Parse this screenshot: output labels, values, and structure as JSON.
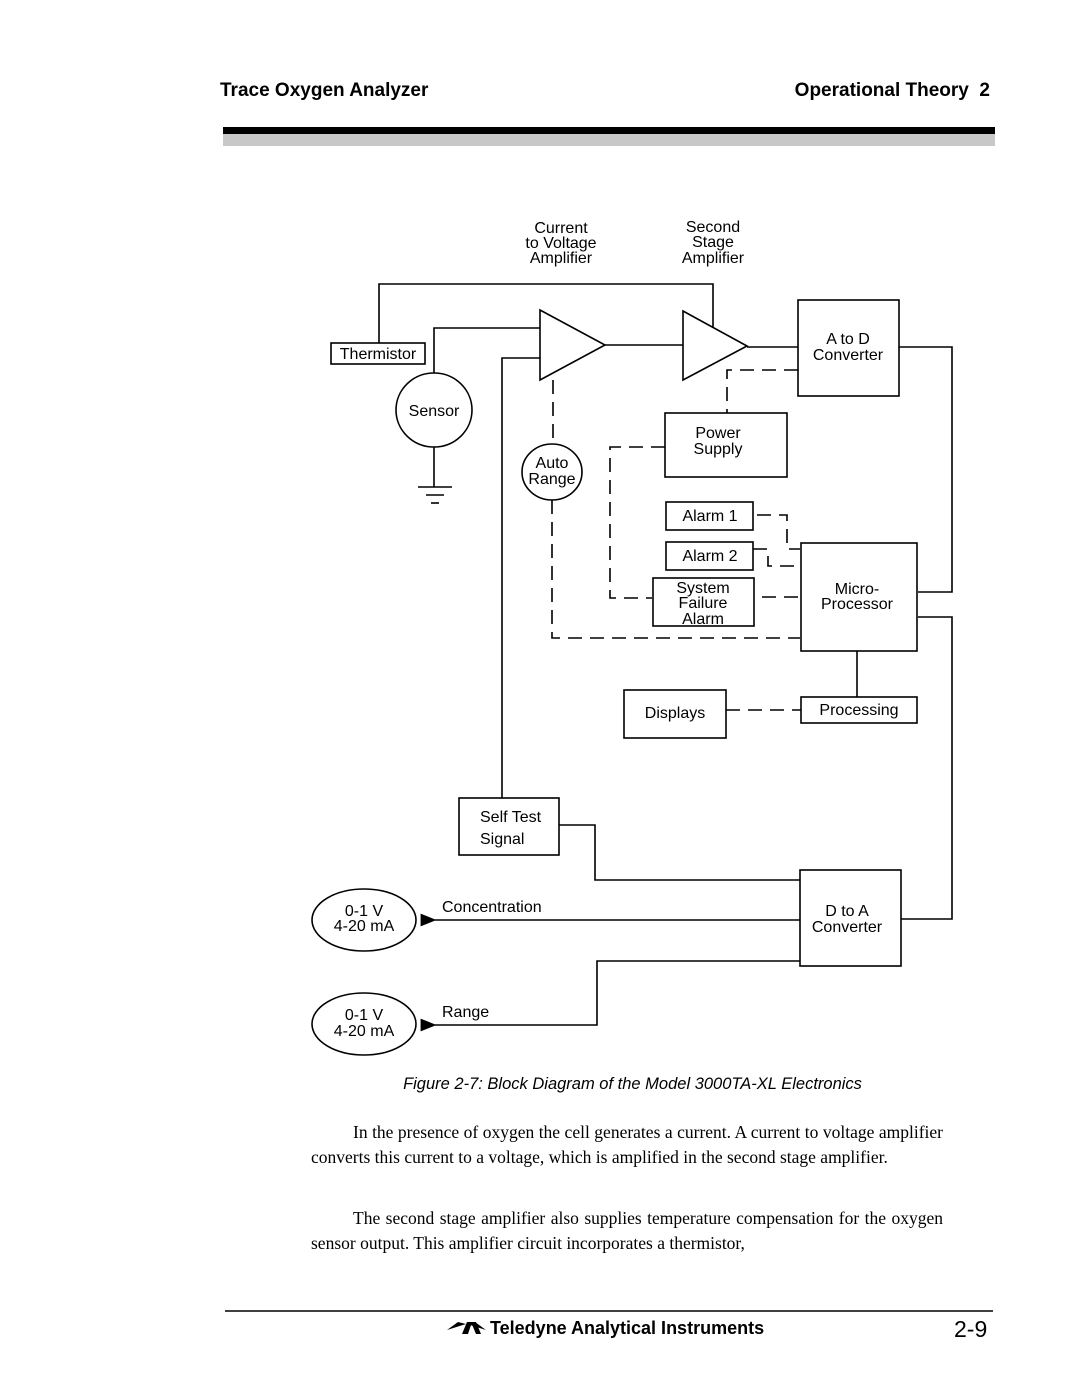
{
  "header": {
    "left_title": "Trace Oxygen Analyzer",
    "right_title": "Operational Theory  2"
  },
  "diagram": {
    "amp1_label": [
      "Current",
      "to Voltage",
      "Amplifier"
    ],
    "amp2_label": [
      "Second",
      "Stage",
      "Amplifier"
    ],
    "thermistor": "Thermistor",
    "sensor": "Sensor",
    "auto_range": [
      "Auto",
      "Range"
    ],
    "a_to_d": [
      "A to D",
      "Converter"
    ],
    "power_supply": [
      "Power",
      "Supply"
    ],
    "alarm1": "Alarm 1",
    "alarm2": "Alarm 2",
    "system_failure": [
      "System",
      "Failure",
      "Alarm"
    ],
    "microprocessor": [
      "Micro-",
      "Processor"
    ],
    "displays": "Displays",
    "processing": "Processing",
    "self_test": [
      "Self Test",
      "Signal"
    ],
    "d_to_a": [
      "D to A",
      "Converter"
    ],
    "concentration_label": "Concentration",
    "range_label": "Range",
    "output1": [
      "0-1 V",
      "4-20 mA"
    ],
    "output2": [
      "0-1 V",
      "4-20 mA"
    ]
  },
  "caption": "Figure 2-7:  Block Diagram of the Model 3000TA-XL Electronics",
  "paragraphs": [
    "In the presence of oxygen the cell generates a current. A current to voltage amplifier converts this current to a voltage, which is amplified in the second stage amplifier.",
    "The second stage amplifier also supplies temperature compensation for the oxygen sensor output. This amplifier circuit incorporates a thermistor,"
  ],
  "footer": {
    "company": "Teledyne Analytical Instruments",
    "logo_icon": "teledyne-logo-icon",
    "page_number": "2-9"
  }
}
